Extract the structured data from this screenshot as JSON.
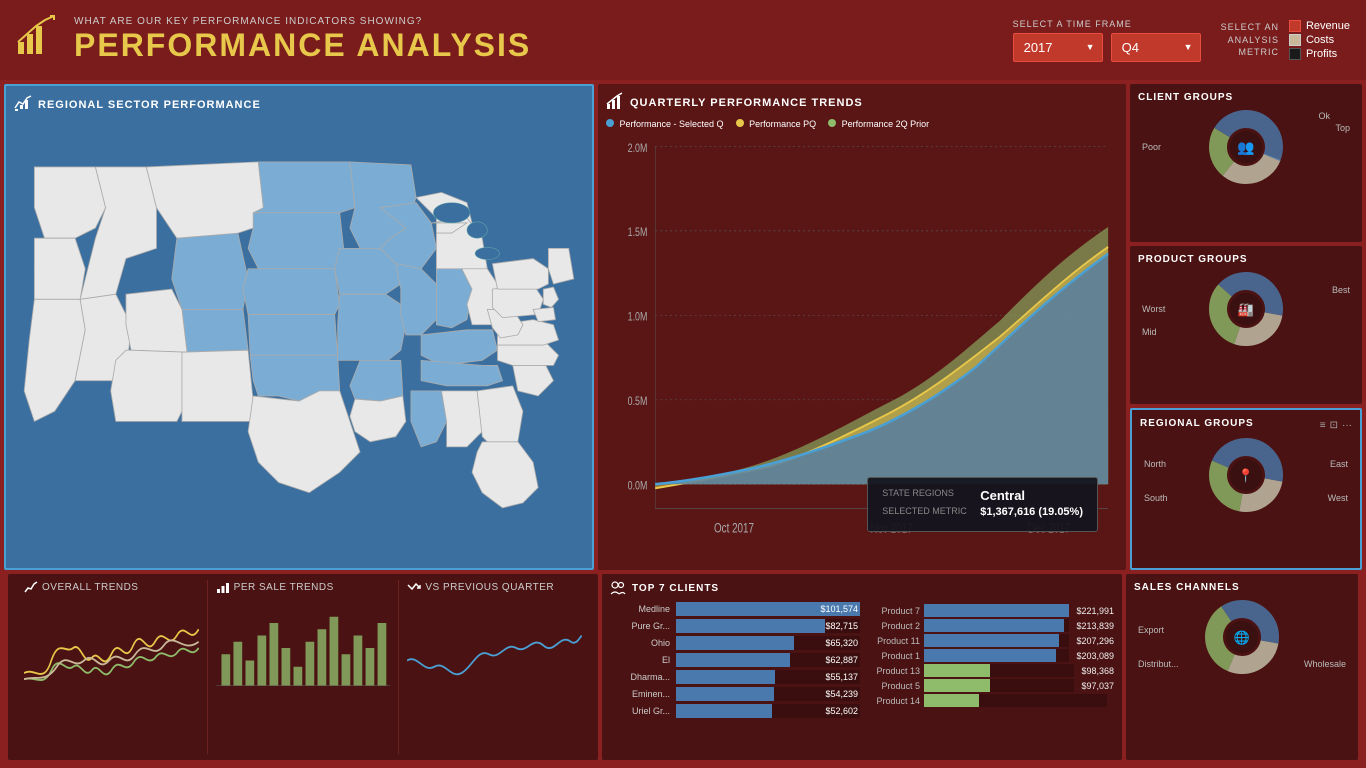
{
  "header": {
    "subtitle": "WHAT ARE OUR KEY PERFORMANCE INDICATORS SHOWING?",
    "title": "PERFORMANCE ANALYSIS",
    "timeframe_label": "SELECT A TIME FRAME",
    "year_value": "2017",
    "quarter_value": "Q4",
    "analysis_label1": "SELECT AN",
    "analysis_label2": "ANALYSIS",
    "analysis_label3": "METRIC",
    "legend": [
      {
        "label": "Revenue",
        "color": "#c0392b"
      },
      {
        "label": "Costs",
        "color": "#c9b99a"
      },
      {
        "label": "Profits",
        "color": "#2c2c2c"
      }
    ]
  },
  "regional_panel": {
    "title": "REGIONAL SECTOR PERFORMANCE"
  },
  "quarterly_panel": {
    "title": "QUARTERLY PERFORMANCE TRENDS",
    "legend": [
      {
        "label": "Performance - Selected Q",
        "color": "#4a9fd4"
      },
      {
        "label": "Performance PQ",
        "color": "#e8c84a"
      },
      {
        "label": "Performance 2Q Prior",
        "color": "#8fbc6a"
      }
    ],
    "y_labels": [
      "2.0M",
      "1.5M",
      "1.0M",
      "0.5M",
      "0.0M"
    ],
    "x_labels": [
      "Oct 2017",
      "Nov 2017",
      "Dec 2017"
    ]
  },
  "client_groups_panel": {
    "title": "CLIENT GROUPS",
    "labels": {
      "poor": "Poor",
      "ok": "Ok",
      "top": "Top"
    },
    "donut_icon": "👥"
  },
  "product_groups_panel": {
    "title": "PRODUCT GROUPS",
    "labels": {
      "worst": "Worst",
      "mid": "Mid",
      "best": "Best"
    },
    "donut_icon": "🏭"
  },
  "regional_groups_panel": {
    "title": "REGIONAL GROUPS",
    "labels": {
      "north": "North",
      "south": "South",
      "east": "East",
      "west": "West"
    },
    "donut_icon": "📍"
  },
  "sales_channels_panel": {
    "title": "SALES CHANNELS",
    "labels": {
      "export": "Export",
      "distribut": "Distribut...",
      "wholesale": "Wholesale"
    },
    "donut_icon": "🌐"
  },
  "tooltip": {
    "state_regions_label": "STATE REGIONS",
    "state_regions_value": "Central",
    "selected_metric_label": "SELECTED METRIC",
    "selected_metric_value": "$1,367,616 (19.05%)"
  },
  "top7_clients": {
    "title": "TOP 7 CLIENTS",
    "clients": [
      {
        "name": "Medline",
        "value": "$101,574",
        "pct": 100
      },
      {
        "name": "Pure Gr...",
        "value": "$82,715",
        "pct": 81
      },
      {
        "name": "Ohio",
        "value": "$65,320",
        "pct": 64
      },
      {
        "name": "El",
        "value": "$62,887",
        "pct": 62
      },
      {
        "name": "Dharma...",
        "value": "$55,137",
        "pct": 54
      },
      {
        "name": "Eminen...",
        "value": "$54,239",
        "pct": 53
      },
      {
        "name": "Uriel Gr...",
        "value": "$52,602",
        "pct": 52
      }
    ]
  },
  "top_products": {
    "products": [
      {
        "name": "Product 7",
        "value": "$221,991",
        "pct": 100,
        "color": "#4a7aad"
      },
      {
        "name": "Product 2",
        "value": "$213,839",
        "pct": 96,
        "color": "#4a7aad"
      },
      {
        "name": "Product 11",
        "value": "$207,296",
        "pct": 93,
        "color": "#4a7aad"
      },
      {
        "name": "Product 1",
        "value": "$203,089",
        "pct": 91,
        "color": "#4a7aad"
      },
      {
        "name": "Product 13",
        "value": "$98,368",
        "pct": 44,
        "color": "#8fbc6a"
      },
      {
        "name": "Product 5",
        "value": "$97,037",
        "pct": 44,
        "color": "#8fbc6a"
      },
      {
        "name": "Product 14",
        "value": "",
        "pct": 30,
        "color": "#8fbc6a"
      }
    ]
  },
  "bottom_trends": [
    {
      "label": "OVERALL TRENDS",
      "icon": "📈"
    },
    {
      "label": "PER SALE TRENDS",
      "icon": "📊"
    },
    {
      "label": "VS PREVIOUS QUARTER",
      "icon": "📉"
    }
  ]
}
